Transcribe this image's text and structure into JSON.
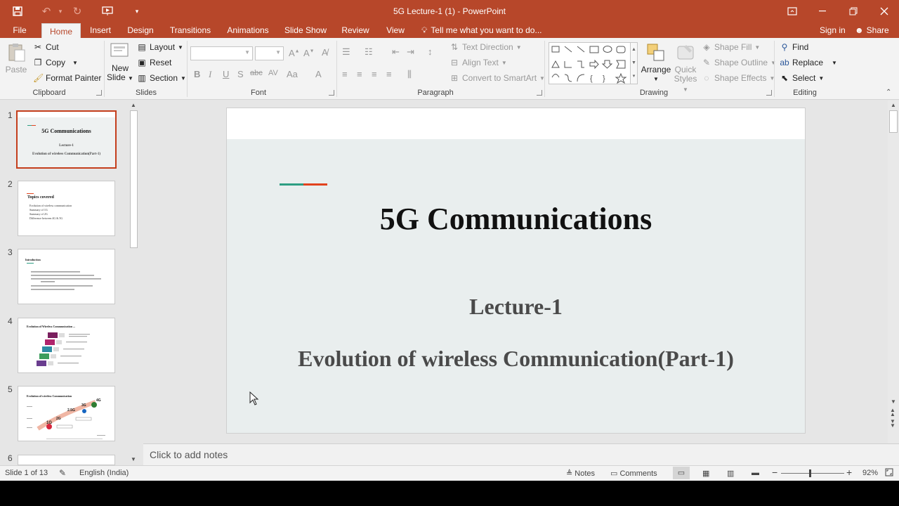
{
  "window": {
    "title": "5G Lecture-1 (1) - PowerPoint",
    "accent": "#b7472a"
  },
  "tabs": [
    "File",
    "Home",
    "Insert",
    "Design",
    "Transitions",
    "Animations",
    "Slide Show",
    "Review",
    "View"
  ],
  "tell_me": "Tell me what you want to do...",
  "account": {
    "sign_in": "Sign in",
    "share": "Share"
  },
  "ribbon": {
    "clipboard": {
      "paste": "Paste",
      "cut": "Cut",
      "copy": "Copy",
      "format_painter": "Format Painter",
      "label": "Clipboard"
    },
    "slides": {
      "new_slide_1": "New",
      "new_slide_2": "Slide",
      "layout": "Layout",
      "reset": "Reset",
      "section": "Section",
      "label": "Slides"
    },
    "font": {
      "label": "Font"
    },
    "paragraph": {
      "text_direction": "Text Direction",
      "align_text": "Align Text",
      "convert": "Convert to SmartArt",
      "label": "Paragraph"
    },
    "drawing": {
      "arrange": "Arrange",
      "quick_styles_1": "Quick",
      "quick_styles_2": "Styles",
      "shape_fill": "Shape Fill",
      "shape_outline": "Shape Outline",
      "shape_effects": "Shape Effects",
      "label": "Drawing"
    },
    "editing": {
      "find": "Find",
      "replace": "Replace",
      "select": "Select",
      "label": "Editing"
    }
  },
  "thumbnails": [
    {
      "num": "1",
      "title": "5G Communications",
      "line1": "Lecture-1",
      "line2": "Evolution of wireless  Communication(Part-1)"
    },
    {
      "num": "2",
      "title": "Topics covered",
      "bullets": [
        "Evolution of wireless communication",
        "Summary of 1G",
        "Summary of 2G",
        "Difference between 4G & 5G"
      ]
    },
    {
      "num": "3",
      "title": "Introduction"
    },
    {
      "num": "4",
      "title": "Evolution of Wireless Communication ..."
    },
    {
      "num": "5",
      "title": "Evolution of wireless Communication",
      "labels": [
        "2.5G",
        "3G",
        "4G",
        "2G",
        "1G"
      ]
    },
    {
      "num": "6"
    }
  ],
  "slide": {
    "title": "5G Communications",
    "subtitle1": "Lecture-1",
    "subtitle2": "Evolution of wireless Communication(Part-1)",
    "accent_line_colors": [
      "#2e9e83",
      "#e2421d"
    ]
  },
  "notes_placeholder": "Click to add notes",
  "status": {
    "slide_of": "Slide 1 of 13",
    "language": "English (India)",
    "notes": "Notes",
    "comments": "Comments",
    "zoom": "92%",
    "zoom_fraction": 0.46
  }
}
